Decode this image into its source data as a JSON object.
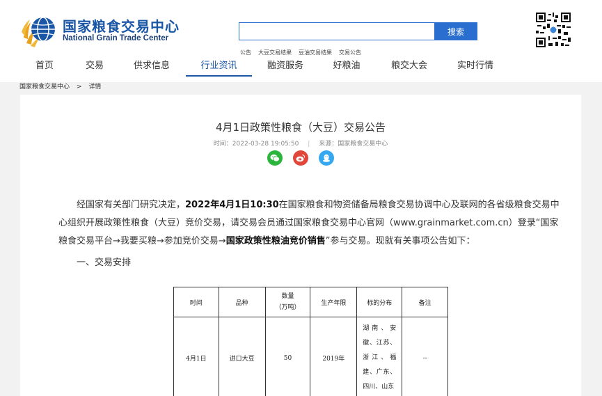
{
  "header": {
    "logo_cn": "国家粮食交易中心",
    "logo_en": "National Grain Trade Center",
    "search": {
      "value": "",
      "button": "搜索"
    },
    "hot_links": [
      "公告",
      "大豆交易结果",
      "豆油交易结果",
      "交易公告"
    ]
  },
  "nav": {
    "items": [
      "首页",
      "交易",
      "供求信息",
      "行业资讯",
      "融资服务",
      "好粮油",
      "粮交大会",
      "实时行情"
    ],
    "active": "行业资讯"
  },
  "breadcrumb": {
    "home": "国家粮食交易中心",
    "separator": ">",
    "current": "详情"
  },
  "article": {
    "title": "4月1日政策性粮食（大豆）交易公告",
    "time": "时间：2022-03-28 19:05:50",
    "meta_sep": "|",
    "source": "来源：国家粮食交易中心",
    "share_icons": [
      "wechat-icon",
      "weibo-icon",
      "qq-icon"
    ],
    "para_a": "经国家有关部门研究决定，",
    "para_b": "2022年4月1日10:30",
    "para_c": "在国家粮食和物资储备局粮食交易协调中心及联网的各省级粮食交易中心组织开展政策性粮食（大豆）竞价交易，请交易会员通过国家粮食交易中心官网（www.grainmarket.com.cn）登录“国家粮食交易平台→我要买粮→参加竞价交易→",
    "para_d": "国家政策性粮油竞价销售",
    "para_e": "”参与交易。现就有关事项公告如下：",
    "section1": "一、交易安排"
  },
  "table": {
    "headers": {
      "time": "时间",
      "variety": "品种",
      "qty_line1": "数量",
      "qty_line2": "（万吨）",
      "year": "生产年限",
      "distribution": "标的分布",
      "remark": "备注"
    },
    "row": {
      "time": "4月1日",
      "variety": "进口大豆",
      "qty": "50",
      "year": "2019年",
      "distribution": "湖南、安徽、江苏、浙江、福建、广东、四川、山东",
      "remark": "--"
    }
  },
  "colors": {
    "brand_blue": "#1a56a6",
    "search_blue": "#2a6fcf",
    "wechat": "#2cb53c",
    "weibo": "#e0473a",
    "qq": "#36a8f0"
  }
}
